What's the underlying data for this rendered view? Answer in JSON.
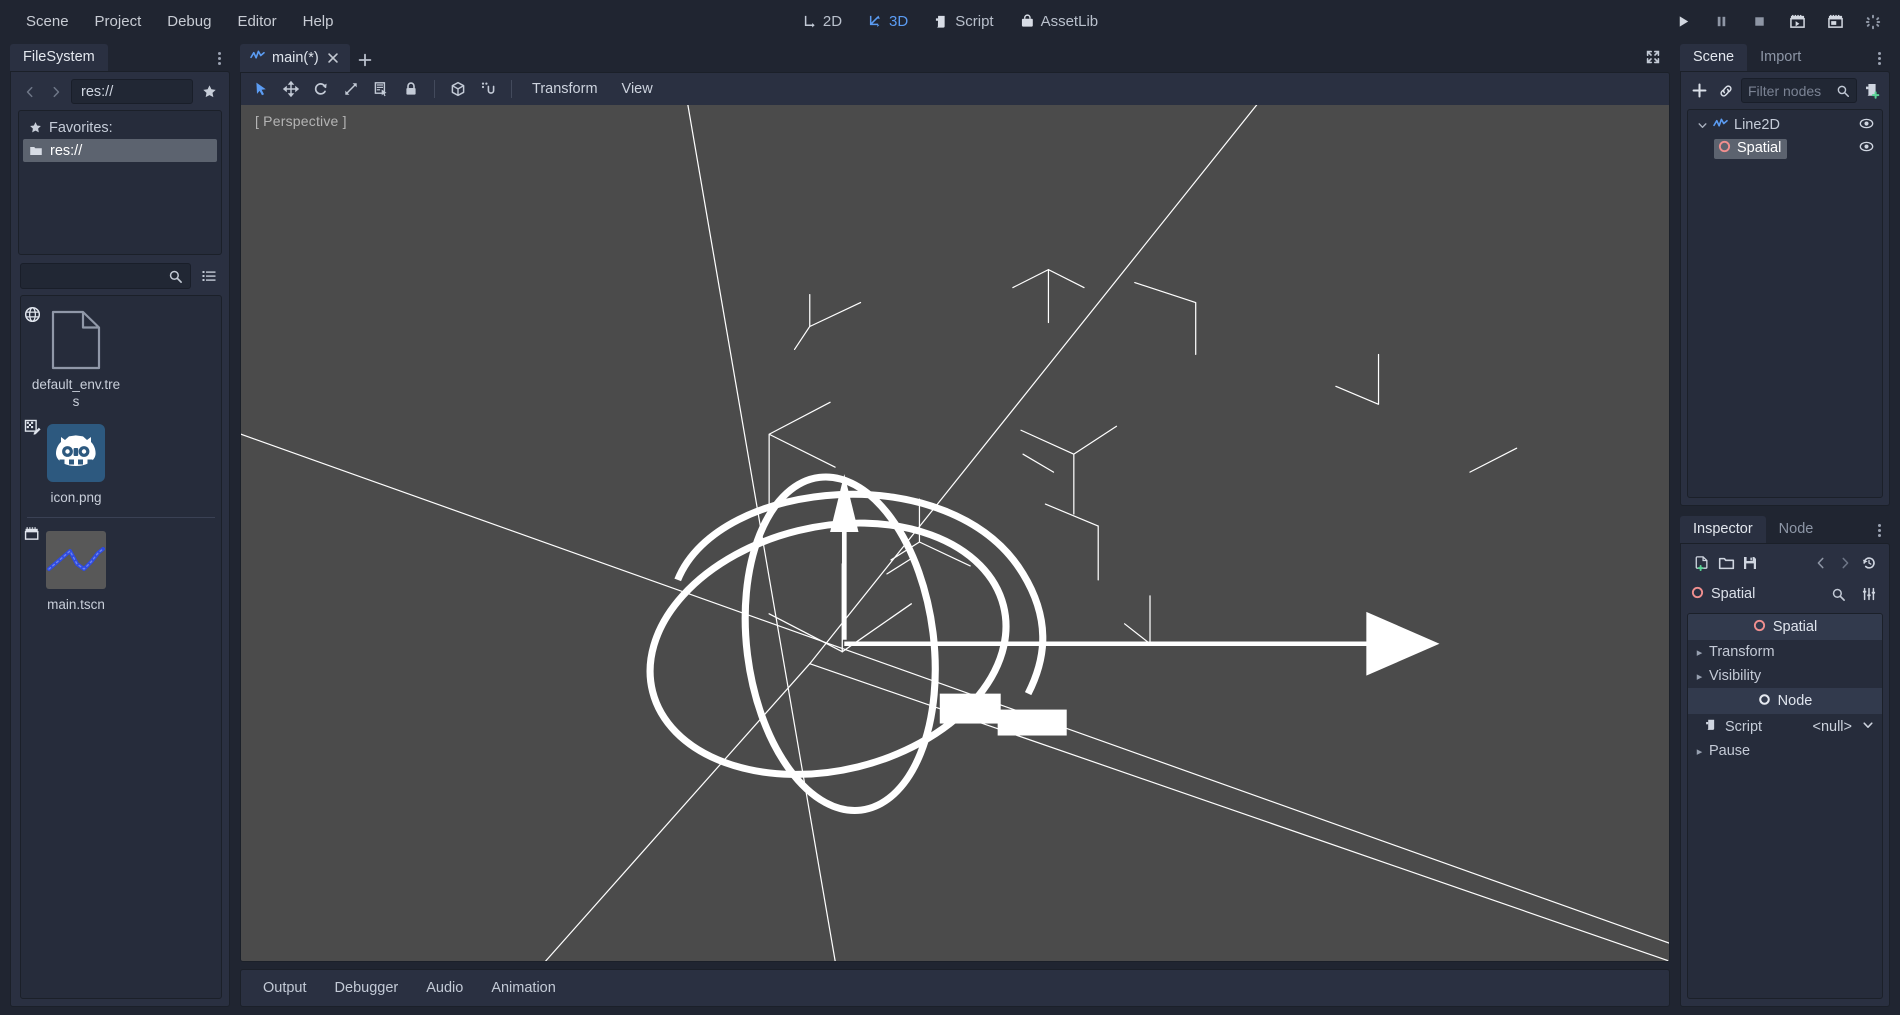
{
  "menu": {
    "items": [
      {
        "label": "Scene"
      },
      {
        "label": "Project"
      },
      {
        "label": "Debug"
      },
      {
        "label": "Editor"
      },
      {
        "label": "Help"
      }
    ],
    "center_tabs": [
      {
        "label": "2D",
        "icon": "2d-icon",
        "active": false
      },
      {
        "label": "3D",
        "icon": "3d-icon",
        "active": true
      },
      {
        "label": "Script",
        "icon": "script-icon",
        "active": false
      },
      {
        "label": "AssetLib",
        "icon": "assetlib-icon",
        "active": false
      }
    ],
    "playback": [
      {
        "icon": "play-icon"
      },
      {
        "icon": "pause-icon"
      },
      {
        "icon": "stop-icon"
      },
      {
        "icon": "play-scene-icon"
      },
      {
        "icon": "play-custom-scene-icon"
      },
      {
        "icon": "spinner-icon"
      }
    ]
  },
  "filesystem": {
    "tab_label": "FileSystem",
    "path_value": "res://",
    "favorites_label": "Favorites:",
    "favorites_items": [
      {
        "label": "res://",
        "selected": true
      }
    ],
    "search_placeholder": "",
    "files": [
      {
        "name": "default_env.tres",
        "type": "resource",
        "selected": false,
        "badge": "globe-icon"
      },
      {
        "name": "icon.png",
        "type": "image",
        "selected": true,
        "badge": "image-import-icon"
      },
      {
        "name": "main.tscn",
        "type": "scene",
        "selected": false,
        "badge": "scene-icon"
      }
    ]
  },
  "scene_tabs": [
    {
      "label": "main(*)",
      "icon": "line2d-icon",
      "active": true
    }
  ],
  "viewport": {
    "toolbar_tools": [
      {
        "name": "select-mode",
        "icon": "cursor-icon",
        "active": true
      },
      {
        "name": "move-mode",
        "icon": "move-icon",
        "active": false
      },
      {
        "name": "rotate-mode",
        "icon": "rotate-icon",
        "active": false
      },
      {
        "name": "scale-mode",
        "icon": "scale-icon",
        "active": false
      },
      {
        "name": "list-select",
        "icon": "list-select-icon",
        "active": false
      },
      {
        "name": "lock",
        "icon": "lock-icon",
        "active": false
      }
    ],
    "toolbar_tools2": [
      {
        "name": "local-space",
        "icon": "cube-icon",
        "active": false
      },
      {
        "name": "snap-mode",
        "icon": "snap-icon",
        "active": false
      }
    ],
    "menus": [
      {
        "label": "Transform"
      },
      {
        "label": "View"
      }
    ],
    "perspective_label": "[ Perspective ]",
    "background_color": "#4b4b4b"
  },
  "bottom_panel": {
    "tabs": [
      {
        "label": "Output"
      },
      {
        "label": "Debugger"
      },
      {
        "label": "Audio"
      },
      {
        "label": "Animation"
      }
    ]
  },
  "scene_dock": {
    "tabs": [
      {
        "label": "Scene",
        "active": true
      },
      {
        "label": "Import",
        "active": false
      }
    ],
    "filter_placeholder": "Filter nodes",
    "nodes": [
      {
        "label": "Line2D",
        "icon": "line2d-icon",
        "depth": 0,
        "selected": false,
        "expanded": true,
        "visible_toggle": true
      },
      {
        "label": "Spatial",
        "icon": "spatial-icon",
        "depth": 1,
        "selected": true,
        "expanded": false,
        "visible_toggle": true
      }
    ]
  },
  "inspector": {
    "tabs": [
      {
        "label": "Inspector",
        "active": true
      },
      {
        "label": "Node",
        "active": false
      }
    ],
    "toolbar": [
      {
        "name": "new-resource",
        "icon": "new-resource-icon"
      },
      {
        "name": "load-resource",
        "icon": "folder-icon"
      },
      {
        "name": "save-resource",
        "icon": "save-icon"
      },
      {
        "name": "history-prev",
        "icon": "chevron-left-icon"
      },
      {
        "name": "history-next",
        "icon": "chevron-right-icon"
      },
      {
        "name": "history",
        "icon": "history-icon"
      }
    ],
    "object_name": "Spatial",
    "sections": [
      {
        "type": "category",
        "label": "Spatial",
        "icon": "spatial-icon"
      },
      {
        "type": "group",
        "label": "Transform"
      },
      {
        "type": "group",
        "label": "Visibility"
      },
      {
        "type": "category",
        "label": "Node",
        "icon": "node-icon"
      },
      {
        "type": "script",
        "label": "Script",
        "value": "<null>"
      },
      {
        "type": "group",
        "label": "Pause"
      }
    ]
  },
  "colors": {
    "accent": "#5b9cf3",
    "panel": "#2a3041",
    "panel_inner": "#262c3b",
    "background": "#202531",
    "viewport": "#4b4b4b",
    "selection": "#5c636f",
    "spatial_icon": "#f08f8f",
    "text": "#c5ccd8"
  }
}
